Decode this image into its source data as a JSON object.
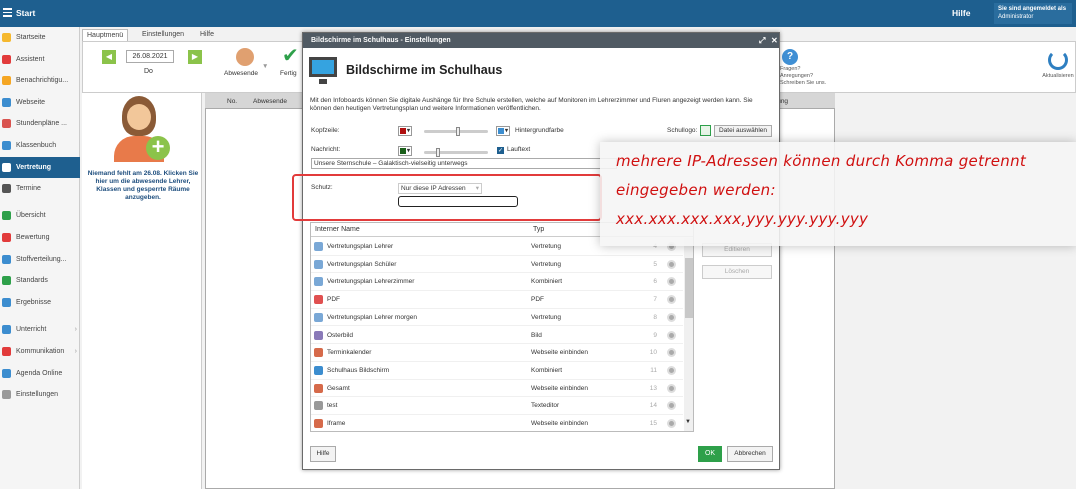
{
  "topbar": {
    "title": "Start",
    "help": "Hilfe",
    "user_line1": "Sie sind angemeldet als",
    "user_line2": "Administrator"
  },
  "sidebar": {
    "items": [
      {
        "label": "Startseite",
        "color": "#f5b82e"
      },
      {
        "label": "Assistent",
        "color": "#e23b3b"
      },
      {
        "label": "Benachrichtigu...",
        "color": "#f5a623"
      },
      {
        "label": "Webseite",
        "color": "#3c8dcf"
      },
      {
        "label": "Stundenpläne ...",
        "color": "#d9534f"
      },
      {
        "label": "Klassenbuch",
        "color": "#3c8dcf"
      },
      {
        "label": "Vertretung",
        "color": "#ffffff"
      },
      {
        "label": "Termine",
        "color": "#555555"
      },
      {
        "label": "Übersicht",
        "color": "#2ea04a"
      },
      {
        "label": "Bewertung",
        "color": "#e23b3b"
      },
      {
        "label": "Stoffverteilung...",
        "color": "#3c8dcf"
      },
      {
        "label": "Standards",
        "color": "#2ea04a"
      },
      {
        "label": "Ergebnisse",
        "color": "#3c8dcf"
      },
      {
        "label": "Unterricht",
        "color": "#3c8dcf"
      },
      {
        "label": "Kommunikation",
        "color": "#e23b3b"
      },
      {
        "label": "Agenda Online",
        "color": "#3c8dcf"
      },
      {
        "label": "Einstellungen",
        "color": "#999999"
      }
    ]
  },
  "tabs": [
    "Hauptmenü",
    "Einstellungen",
    "Hilfe"
  ],
  "ribbon": {
    "date": "26.08.2021",
    "dow": "Do",
    "absent": "Abwesende",
    "ready": "Fertig",
    "faq": [
      "Fragen?",
      "Anregungen?",
      "Schreiben Sie uns."
    ],
    "refresh": "Aktualisieren"
  },
  "left": {
    "hint": "Niemand fehlt am 26.08. Klicken Sie hier um die abwesende Lehrer, Klassen und gesperrte Räume anzugeben."
  },
  "grid": {
    "cols": [
      "No.",
      "Abwesende",
      "Vermerkung"
    ]
  },
  "dialog": {
    "window_title": "Bildschirme im Schulhaus - Einstellungen",
    "heading": "Bildschirme im Schulhaus",
    "desc": "Mit den Infoboards können Sie digitale Aushänge für Ihre Schule erstellen, welche auf Monitoren im Lehrerzimmer und Fluren angezeigt werden kann. Sie können den heutigen Vertretungsplan und weitere Informationen veröffentlichen.",
    "kopfzeile": "Kopfzeile:",
    "hintergrund": "Hintergrundfarbe",
    "schullogo": "Schullogo:",
    "datei": "Datei auswählen",
    "nachricht": "Nachricht:",
    "lauftext": "Lauftext",
    "ticker": "Unsere Sternschule – Galaktisch-vielseitig unterwegs",
    "schutz": "Schutz:",
    "schutz_value": "Nur diese IP Adressen",
    "colors": {
      "kopf": "#b01010",
      "hintergrund": "#3c8dcf",
      "nachricht": "#1a5f1a"
    },
    "table": {
      "col_name": "Interner Name",
      "col_type": "Typ",
      "rows": [
        {
          "name": "Vertretungsplan Lehrer",
          "type": "Vertretung",
          "no": "4",
          "icon": "#7aa8d6"
        },
        {
          "name": "Vertretungsplan Schüler",
          "type": "Vertretung",
          "no": "5",
          "icon": "#7aa8d6"
        },
        {
          "name": "Vertretungsplan Lehrerzimmer",
          "type": "Kombiniert",
          "no": "6",
          "icon": "#7aa8d6"
        },
        {
          "name": "PDF",
          "type": "PDF",
          "no": "7",
          "icon": "#e05050"
        },
        {
          "name": "Vertretungsplan Lehrer morgen",
          "type": "Vertretung",
          "no": "8",
          "icon": "#7aa8d6"
        },
        {
          "name": "Osterbild",
          "type": "Bild",
          "no": "9",
          "icon": "#8a7ab8"
        },
        {
          "name": "Terminkalender",
          "type": "Webseite einbinden",
          "no": "10",
          "icon": "#d66a4a"
        },
        {
          "name": "Schulhaus Bildschirm",
          "type": "Kombiniert",
          "no": "11",
          "icon": "#3c8dcf"
        },
        {
          "name": "Gesamt",
          "type": "Webseite einbinden",
          "no": "13",
          "icon": "#d66a4a"
        },
        {
          "name": "test",
          "type": "Texteditor",
          "no": "14",
          "icon": "#999999"
        },
        {
          "name": "Iframe",
          "type": "Webseite einbinden",
          "no": "15",
          "icon": "#d66a4a"
        }
      ]
    },
    "edit": "Editieren",
    "delete": "Löschen",
    "help_btn": "Hilfe",
    "ok": "OK",
    "cancel": "Abbrechen"
  },
  "annotation": [
    "mehrere IP-Adressen können durch Komma getrennt",
    "eingegeben werden:",
    "xxx.xxx.xxx.xxx,yyy.yyy.yyy.yyy"
  ]
}
